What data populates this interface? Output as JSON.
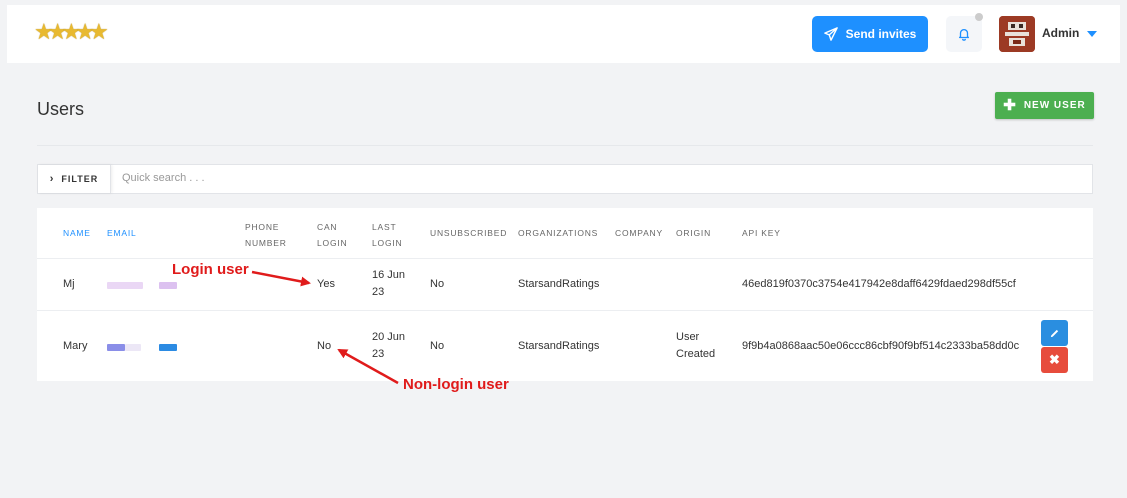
{
  "header": {
    "send_invites_label": "Send invites",
    "user_name": "Admin"
  },
  "page": {
    "title": "Users",
    "new_user_label": "NEW USER"
  },
  "filter": {
    "button_label": "FILTER",
    "search_placeholder": "Quick search . . ."
  },
  "table": {
    "columns": {
      "name": "NAME",
      "email": "EMAIL",
      "phone_1": "PHONE",
      "phone_2": "NUMBER",
      "can_login_1": "CAN",
      "can_login_2": "LOGIN",
      "last_login_1": "LAST",
      "last_login_2": "LOGIN",
      "unsubscribed": "UNSUBSCRIBED",
      "organizations": "ORGANIZATIONS",
      "company": "COMPANY",
      "origin": "ORIGIN",
      "api_key": "API KEY"
    },
    "rows": [
      {
        "name": "Mj",
        "can_login": "Yes",
        "last_login_1": "16 Jun",
        "last_login_2": "23",
        "unsubscribed": "No",
        "organization": "StarsandRatings",
        "origin_1": "",
        "origin_2": "",
        "api_key": "46ed819f0370c3754e417942e8daff6429fdaed298df55cf"
      },
      {
        "name": "Mary",
        "can_login": "No",
        "last_login_1": "20 Jun",
        "last_login_2": "23",
        "unsubscribed": "No",
        "organization": "StarsandRatings",
        "origin_1": "User",
        "origin_2": "Created",
        "api_key": "9f9b4a0868aac50e06ccc86cbf90f9bf514c2333ba58dd0c"
      }
    ]
  },
  "annotations": {
    "login_user": "Login user",
    "non_login_user": "Non-login user"
  },
  "colors": {
    "primary": "#1e90ff",
    "success": "#4caf50",
    "danger": "#e74c3c",
    "annotation": "#e01b1b"
  },
  "icons": [
    "star-icon",
    "paper-plane-icon",
    "bell-icon",
    "chevron-down-icon",
    "plus-icon",
    "chevron-right-icon",
    "pencil-icon",
    "close-icon"
  ]
}
